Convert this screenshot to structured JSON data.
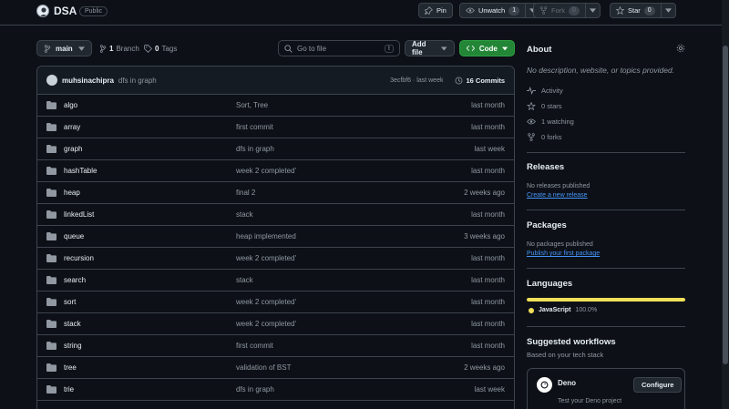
{
  "repo": {
    "name": "DSA",
    "visibility": "Public"
  },
  "header_actions": {
    "pin": "Pin",
    "unwatch": "Unwatch",
    "watch_count": "1",
    "fork": "Fork",
    "fork_count": "0",
    "star": "Star",
    "star_count": "0"
  },
  "toolbar": {
    "branch": "main",
    "branches_count": "1",
    "branches_label": "Branch",
    "tags_count": "0",
    "tags_label": "Tags",
    "goto_placeholder": "Go to file",
    "goto_shortcut": "t",
    "add_file": "Add file",
    "code": "Code"
  },
  "latest_commit": {
    "author": "muhsinachipra",
    "message": "dfs in graph",
    "hash_time": "3ecfbf6 · last week",
    "commits": "16 Commits"
  },
  "files": [
    {
      "name": "algo",
      "message": "Sort, Tree",
      "age": "last month"
    },
    {
      "name": "array",
      "message": "first commit",
      "age": "last month"
    },
    {
      "name": "graph",
      "message": "dfs in graph",
      "age": "last week"
    },
    {
      "name": "hashTable",
      "message": "week 2 completed'",
      "age": "last month"
    },
    {
      "name": "heap",
      "message": "final 2",
      "age": "2 weeks ago"
    },
    {
      "name": "linkedList",
      "message": "stack",
      "age": "last month"
    },
    {
      "name": "queue",
      "message": "heap implemented",
      "age": "3 weeks ago"
    },
    {
      "name": "recursion",
      "message": "week 2 completed'",
      "age": "last month"
    },
    {
      "name": "search",
      "message": "stack",
      "age": "last month"
    },
    {
      "name": "sort",
      "message": "week 2 completed'",
      "age": "last month"
    },
    {
      "name": "stack",
      "message": "week 2 completed'",
      "age": "last month"
    },
    {
      "name": "string",
      "message": "first commit",
      "age": "last month"
    },
    {
      "name": "tree",
      "message": "validation of BST",
      "age": "2 weeks ago"
    },
    {
      "name": "trie",
      "message": "dfs in graph",
      "age": "last week"
    }
  ],
  "about": {
    "title": "About",
    "description": "No description, website, or topics provided.",
    "activity": "Activity",
    "stars": "0 stars",
    "watching": "1 watching",
    "forks": "0 forks"
  },
  "releases": {
    "title": "Releases",
    "text": "No releases published",
    "link": "Create a new release"
  },
  "packages": {
    "title": "Packages",
    "text": "No packages published",
    "link": "Publish your first package"
  },
  "languages": {
    "title": "Languages",
    "items": [
      {
        "name": "JavaScript",
        "percent": "100.0%",
        "share": 100,
        "color": "#f1e05a"
      }
    ]
  },
  "workflows": {
    "title": "Suggested workflows",
    "subtitle": "Based on your tech stack",
    "card_name": "Deno",
    "card_desc": "Test your Deno project",
    "configure": "Configure"
  },
  "colors": {
    "accent_link": "#4493f8",
    "code_green": "#238636",
    "folder_icon": "#9198a1"
  }
}
